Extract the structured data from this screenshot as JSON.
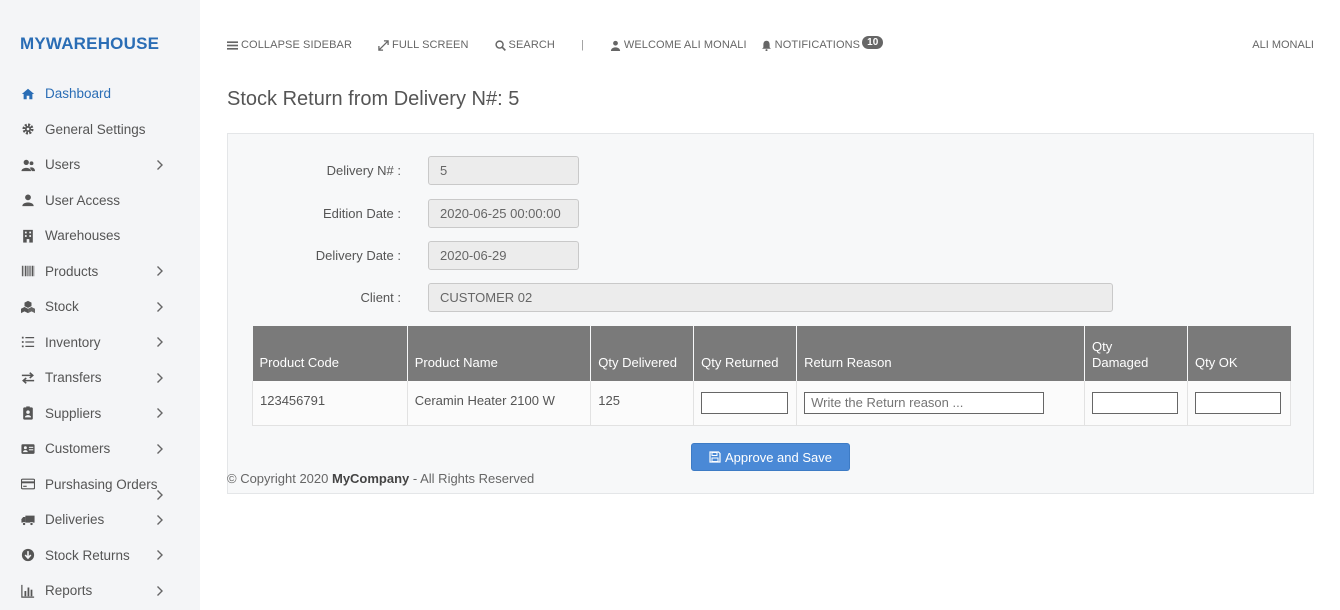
{
  "brand": "MYWAREHOUSE",
  "sidebar": {
    "items": [
      {
        "label": "Dashboard",
        "icon": "home-icon",
        "chevron": false
      },
      {
        "label": "General Settings",
        "icon": "gear-icon",
        "chevron": false
      },
      {
        "label": "Users",
        "icon": "users-icon",
        "chevron": true
      },
      {
        "label": "User Access",
        "icon": "user-icon",
        "chevron": false
      },
      {
        "label": "Warehouses",
        "icon": "building-icon",
        "chevron": false
      },
      {
        "label": "Products",
        "icon": "barcode-icon",
        "chevron": true
      },
      {
        "label": "Stock",
        "icon": "cubes-icon",
        "chevron": true
      },
      {
        "label": "Inventory",
        "icon": "list-icon",
        "chevron": true
      },
      {
        "label": "Transfers",
        "icon": "exchange-icon",
        "chevron": true
      },
      {
        "label": "Suppliers",
        "icon": "id-badge-icon",
        "chevron": true
      },
      {
        "label": "Customers",
        "icon": "address-card-icon",
        "chevron": true
      },
      {
        "label": "Purshasing Orders",
        "icon": "credit-card-icon",
        "chevron": true
      },
      {
        "label": "Deliveries",
        "icon": "truck-icon",
        "chevron": true
      },
      {
        "label": "Stock Returns",
        "icon": "arrow-circle-down-icon",
        "chevron": true
      },
      {
        "label": "Reports",
        "icon": "bar-chart-icon",
        "chevron": true
      }
    ]
  },
  "topbar": {
    "collapse": "COLLAPSE SIDEBAR",
    "fullscreen": "FULL SCREEN",
    "search": "SEARCH",
    "separator": "|",
    "welcome": "WELCOME ALI MONALI",
    "notifications": "NOTIFICATIONS",
    "notifications_count": "10",
    "user": "ALI MONALI"
  },
  "page": {
    "title": "Stock Return from Delivery N#: 5"
  },
  "form": {
    "delivery_label": "Delivery N# :",
    "delivery_value": "5",
    "edition_label": "Edition Date :",
    "edition_value": "2020-06-25 00:00:00",
    "delivery_date_label": "Delivery Date :",
    "delivery_date_value": "2020-06-29",
    "client_label": "Client :",
    "client_value": "CUSTOMER 02"
  },
  "table": {
    "headers": [
      "Product Code",
      "Product Name",
      "Qty Delivered",
      "Qty Returned",
      "Return Reason",
      "Qty Damaged",
      "Qty OK"
    ],
    "rows": [
      {
        "code": "123456791",
        "name": "Ceramin Heater 2100 W",
        "qty_delivered": "125",
        "qty_returned": "",
        "reason_placeholder": "Write the Return reason ...",
        "qty_damaged": "",
        "qty_ok": ""
      }
    ]
  },
  "actions": {
    "save_label": "Approve and Save"
  },
  "footer": {
    "prefix": "© Copyright 2020 ",
    "company": "MyCompany",
    "suffix": " - All Rights Reserved"
  },
  "colors": {
    "brand": "#2a6db5",
    "button": "#4a89d6",
    "table_header": "#7a7a7a"
  }
}
